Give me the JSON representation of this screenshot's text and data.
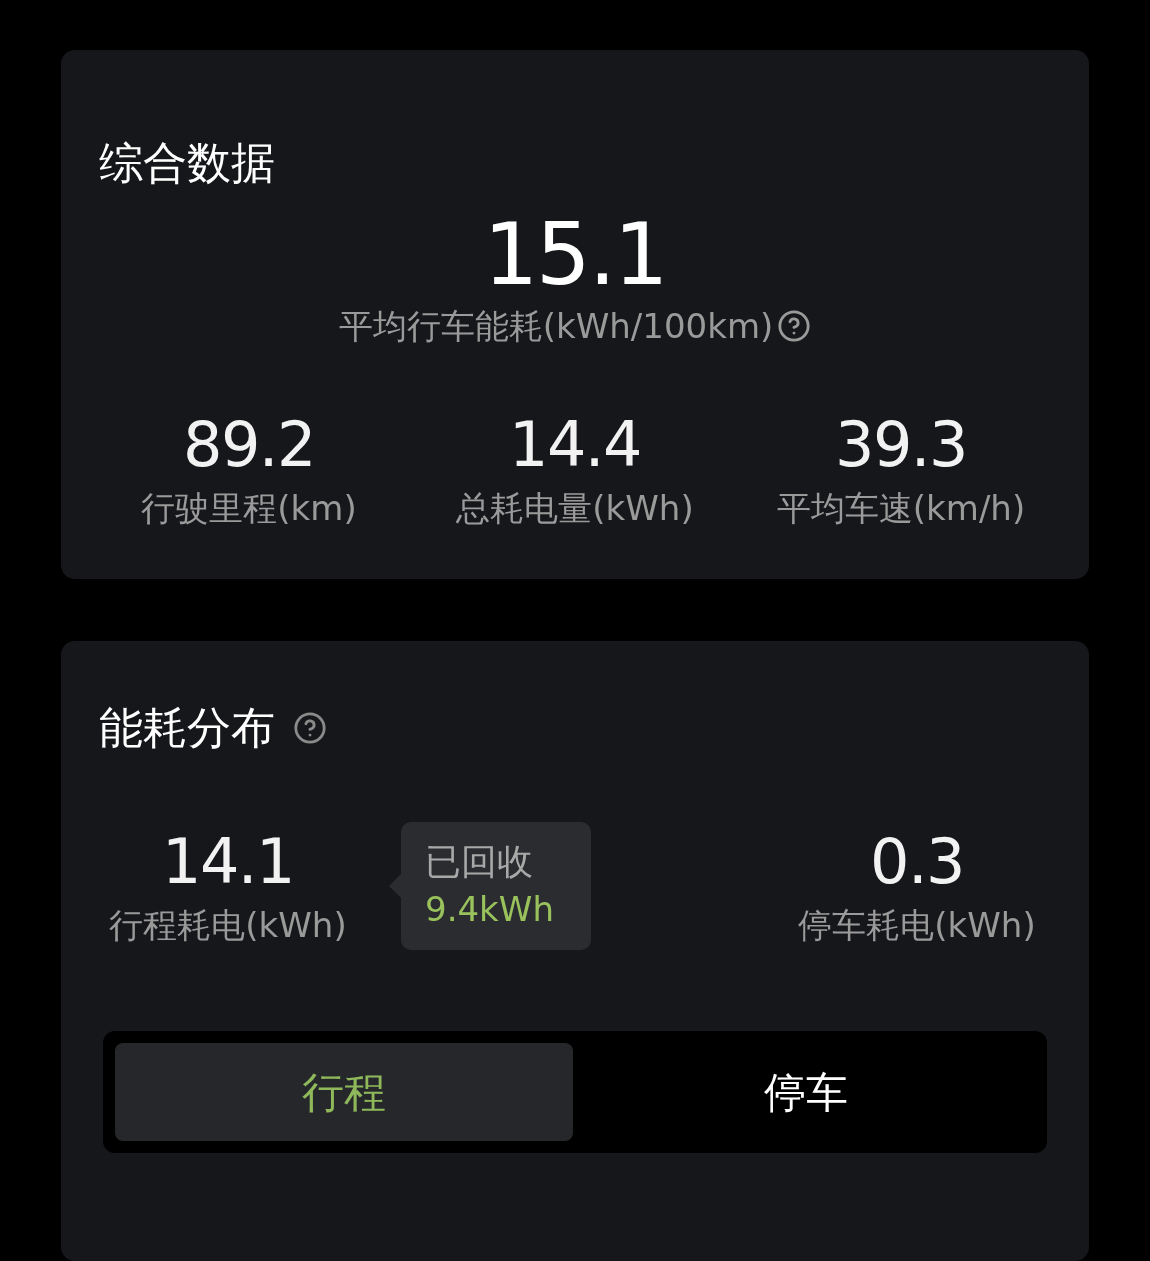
{
  "overview": {
    "title": "综合数据",
    "main_value": "15.1",
    "main_label": "平均行车能耗(kWh/100km)",
    "stats": [
      {
        "value": "89.2",
        "label": "行驶里程(km)"
      },
      {
        "value": "14.4",
        "label": "总耗电量(kWh)"
      },
      {
        "value": "39.3",
        "label": "平均车速(km/h)"
      }
    ]
  },
  "distribution": {
    "title": "能耗分布",
    "trip": {
      "value": "14.1",
      "label": "行程耗电(kWh)"
    },
    "recovered": {
      "label": "已回收",
      "value": "9.4kWh"
    },
    "parking": {
      "value": "0.3",
      "label": "停车耗电(kWh)"
    },
    "tabs": [
      {
        "label": "行程",
        "selected": true
      },
      {
        "label": "停车",
        "selected": false
      }
    ]
  }
}
